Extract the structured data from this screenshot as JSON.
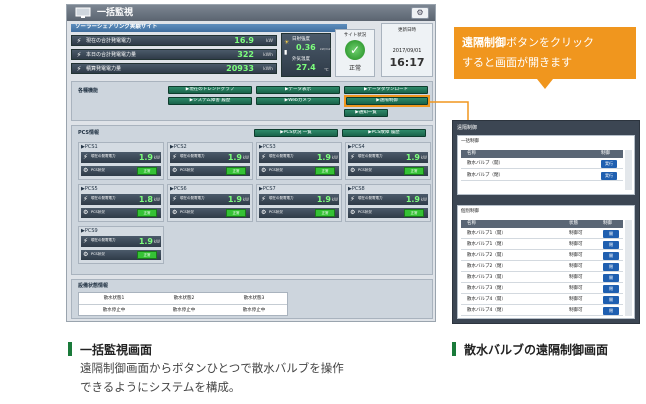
{
  "window": {
    "title": "一括監視",
    "site_label": "ソーラーシェアリング実験サイト",
    "update_label": "更新日時",
    "date": "2017/09/01",
    "time": "16:17",
    "power": [
      {
        "label": "現在の合計発電電力",
        "value": "16.9",
        "unit": "kW"
      },
      {
        "label": "本日の合計発電電力量",
        "value": "322",
        "unit": "kWh"
      },
      {
        "label": "積算発電電力量",
        "value": "20933",
        "unit": "kWh"
      }
    ],
    "weather": {
      "sun_label": "日射強度",
      "sun_value": "0.36",
      "sun_unit": "kW/m2",
      "temp_label": "外気温度",
      "temp_value": "27.4",
      "temp_unit": "℃"
    },
    "site_status": {
      "label": "サイト状況",
      "value": "正常"
    },
    "functions": {
      "header": "各種機能",
      "buttons": [
        "▶現在のトレンドグラフ",
        "▶データ表示",
        "▶データダウンロード",
        "▶システム障害 履歴",
        "▶Webカメラ",
        "▶遠隔制御",
        "▶通知一覧"
      ]
    },
    "pcs_header": "PCS情報",
    "pcs_buttons": [
      "▶PCS状況 一覧",
      "▶PCS故障 履歴"
    ],
    "pcs_power_label": "現在の発電電力",
    "pcs_status_label": "PCS状況",
    "pcs_status_value": "正常",
    "pcs": [
      {
        "name": "▶PCS1",
        "value": "1.9",
        "unit": "kW"
      },
      {
        "name": "▶PCS2",
        "value": "1.9",
        "unit": "kW"
      },
      {
        "name": "▶PCS3",
        "value": "1.9",
        "unit": "kW"
      },
      {
        "name": "▶PCS4",
        "value": "1.9",
        "unit": "kW"
      },
      {
        "name": "▶PCS5",
        "value": "1.8",
        "unit": "kW"
      },
      {
        "name": "▶PCS6",
        "value": "1.9",
        "unit": "kW"
      },
      {
        "name": "▶PCS7",
        "value": "1.9",
        "unit": "kW"
      },
      {
        "name": "▶PCS8",
        "value": "1.9",
        "unit": "kW"
      },
      {
        "name": "▶PCS9",
        "value": "1.9",
        "unit": "kW"
      }
    ],
    "equipment": {
      "header": "設備状態情報",
      "cols": [
        "散水状態1",
        "散水状態2",
        "散水状態3"
      ],
      "vals": [
        "散水停止中",
        "散水停止中",
        "散水停止中"
      ]
    }
  },
  "callout": {
    "highlight": "遠隔制御",
    "line1": "ボタンをクリック",
    "line2": "すると画面が開きます"
  },
  "remote": {
    "title": "遠隔制御",
    "bulk": {
      "header": "一括制御",
      "cols": [
        "名称",
        "制御"
      ],
      "rows": [
        {
          "name": "散水バルブ（開）",
          "btn": "実行"
        },
        {
          "name": "散水バルブ（閉）",
          "btn": "実行"
        }
      ]
    },
    "individual": {
      "header": "個別制御",
      "cols": [
        "名称",
        "状態",
        "制御"
      ],
      "rows": [
        {
          "name": "散水バルブ1（開）",
          "state": "制御可",
          "btn": "開"
        },
        {
          "name": "散水バルブ1（閉）",
          "state": "制御可",
          "btn": "閉"
        },
        {
          "name": "散水バルブ2（開）",
          "state": "制御可",
          "btn": "開"
        },
        {
          "name": "散水バルブ2（閉）",
          "state": "制御可",
          "btn": "閉"
        },
        {
          "name": "散水バルブ3（開）",
          "state": "制御可",
          "btn": "開"
        },
        {
          "name": "散水バルブ3（閉）",
          "state": "制御可",
          "btn": "閉"
        },
        {
          "name": "散水バルブ4（開）",
          "state": "制御可",
          "btn": "開"
        },
        {
          "name": "散水バルブ4（閉）",
          "state": "制御可",
          "btn": "閉"
        }
      ]
    }
  },
  "captions": {
    "left_title": "一括監視画面",
    "left_body1": "遠隔制御画面からボタンひとつで散水バルブを操作",
    "left_body2": "できるようにシステムを構成。",
    "right_title": "散水バルブの遠隔制御画面"
  },
  "colors": {
    "accent": "#f0961e",
    "caption_bar": "#1a7a3a",
    "status_ok": "#35c235"
  }
}
